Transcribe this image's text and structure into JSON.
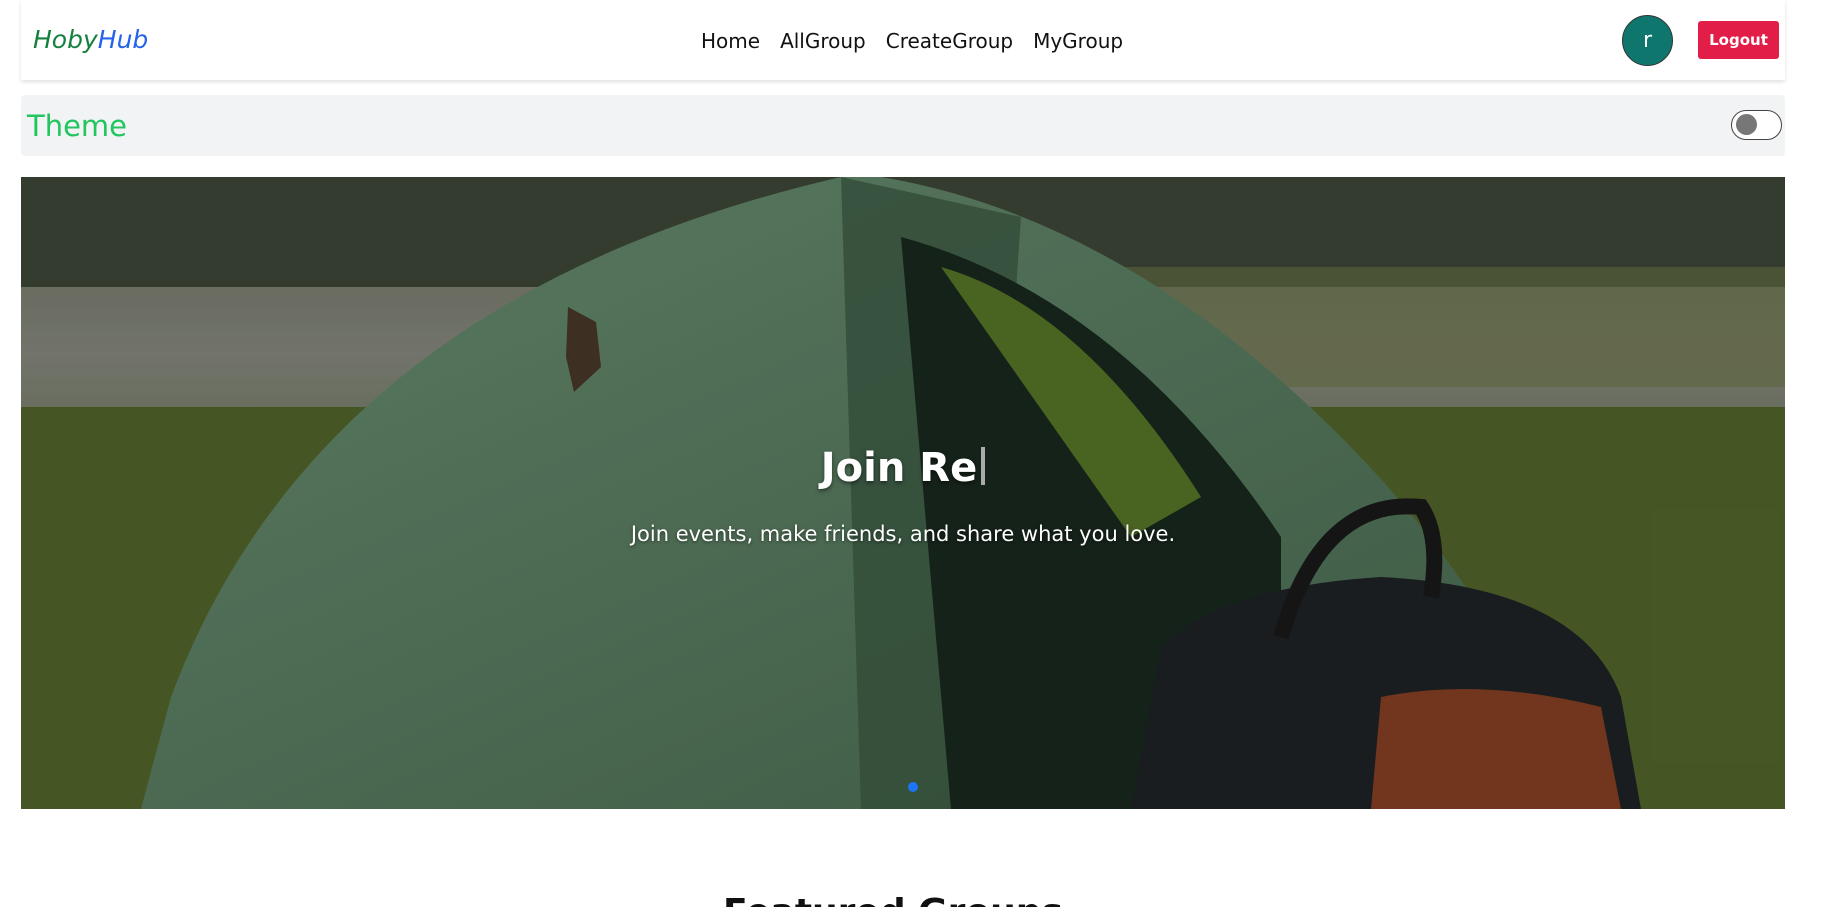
{
  "navbar": {
    "logo_part_a": "Hoby",
    "logo_part_b": "Hub",
    "links": [
      "Home",
      "AllGroup",
      "CreateGroup",
      "MyGroup"
    ],
    "avatar_initial": "r",
    "logout_label": "Logout"
  },
  "theme": {
    "label": "Theme",
    "toggle_state": "off"
  },
  "hero": {
    "title": "Join Re",
    "subtitle": "Join events, make friends, and share what you love.",
    "slide_count": 1,
    "active_slide": 1
  },
  "featured": {
    "title": "Featured Groups"
  },
  "colors": {
    "logo_a": "#15803d",
    "logo_b": "#2563eb",
    "avatar_bg": "#0f766e",
    "logout_bg": "#e11d48",
    "theme_label": "#22c55e",
    "slide_dot": "#1d74f5"
  }
}
